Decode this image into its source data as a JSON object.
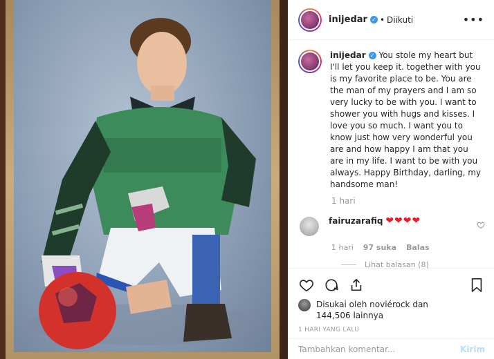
{
  "post": {
    "username": "inijedar",
    "follow_state": "Diikuti",
    "dot": "•",
    "more": "•••"
  },
  "caption": {
    "username": "inijedar",
    "text": "You stole my heart but I'll let you keep it. together with you is my favorite place to be. You are the man of my prayers and I am so very lucky to be with you. I want to shower you with hugs and kisses. I love you so much. I want you to know just how very wonderful you are and how happy I am that you are in my life. I want to be with you always. Happy Birthday, darling, my handsome man!",
    "time": "1 hari"
  },
  "comments": [
    {
      "username": "fairuzarafiq",
      "text": "❤❤❤❤",
      "time": "1 hari",
      "likes": "97 suka",
      "reply_label": "Balas",
      "view_replies": "Lihat balasan (8)"
    }
  ],
  "likes": {
    "liked_by_prefix": "Disukai oleh",
    "liked_by_user": "noviérock",
    "and": "dan",
    "count": "144,506",
    "others": "lainnya"
  },
  "post_date": "1 HARI YANG LALU",
  "add_comment": {
    "placeholder": "Tambahkan komentar...",
    "post_label": "Kirim"
  },
  "colors": {
    "link": "#3897f0",
    "heart": "#ed1c24",
    "muted": "#999999"
  },
  "icons": {
    "like": "heart-icon",
    "comment": "comment-icon",
    "share": "share-icon",
    "save": "bookmark-icon"
  }
}
